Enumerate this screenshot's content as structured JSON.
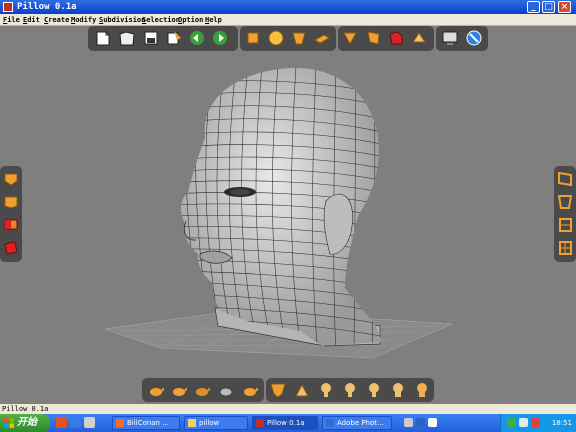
{
  "window": {
    "title": "Pillow 0.1a"
  },
  "menu": [
    "File",
    "Edit",
    "Create",
    "Modify",
    "Subdivision",
    "Selection",
    "Option",
    "Help"
  ],
  "toolbars": {
    "top_file": [
      "new-file-icon",
      "open-file-icon",
      "save-icon",
      "save-as-icon",
      "undo-icon",
      "redo-icon"
    ],
    "top_create": [
      "cube-icon",
      "sphere-icon",
      "cylinder-icon",
      "plane-icon"
    ],
    "top_modify": [
      "extrude-icon",
      "bevel-icon",
      "red-cube-icon",
      "split-icon"
    ],
    "top_view": [
      "monitor-icon",
      "blue-circle-icon"
    ],
    "left": [
      "view-top-icon",
      "view-front-icon",
      "view-side-icon",
      "view-perspective-icon"
    ],
    "right": [
      "frame-1-icon",
      "frame-2-icon",
      "frame-3-icon",
      "frame-4-icon"
    ],
    "bottom_left": [
      "teapot-1-icon",
      "teapot-2-icon",
      "teapot-3-icon",
      "teapot-wire-icon",
      "teapot-5-icon"
    ],
    "bottom_right": [
      "mask-icon",
      "head-1-icon",
      "head-2-icon",
      "head-3-icon",
      "head-4-icon",
      "head-5-icon",
      "head-6-icon"
    ]
  },
  "status": {
    "text": "Pillow 0.1a"
  },
  "taskbar": {
    "start_label": "开始",
    "tasks": [
      {
        "label": "BillConan ...",
        "active": false
      },
      {
        "label": "pillow",
        "active": false
      },
      {
        "label": "Pillow 0.1a",
        "active": true
      },
      {
        "label": "Adobe Phot...",
        "active": false
      }
    ],
    "clock": "18:51"
  },
  "colors": {
    "accent": "#2459d8",
    "toolbar_bg": "#4a4a4a",
    "viewport_bg": "#7f7f7f",
    "icon_orange": "#f0a030"
  }
}
